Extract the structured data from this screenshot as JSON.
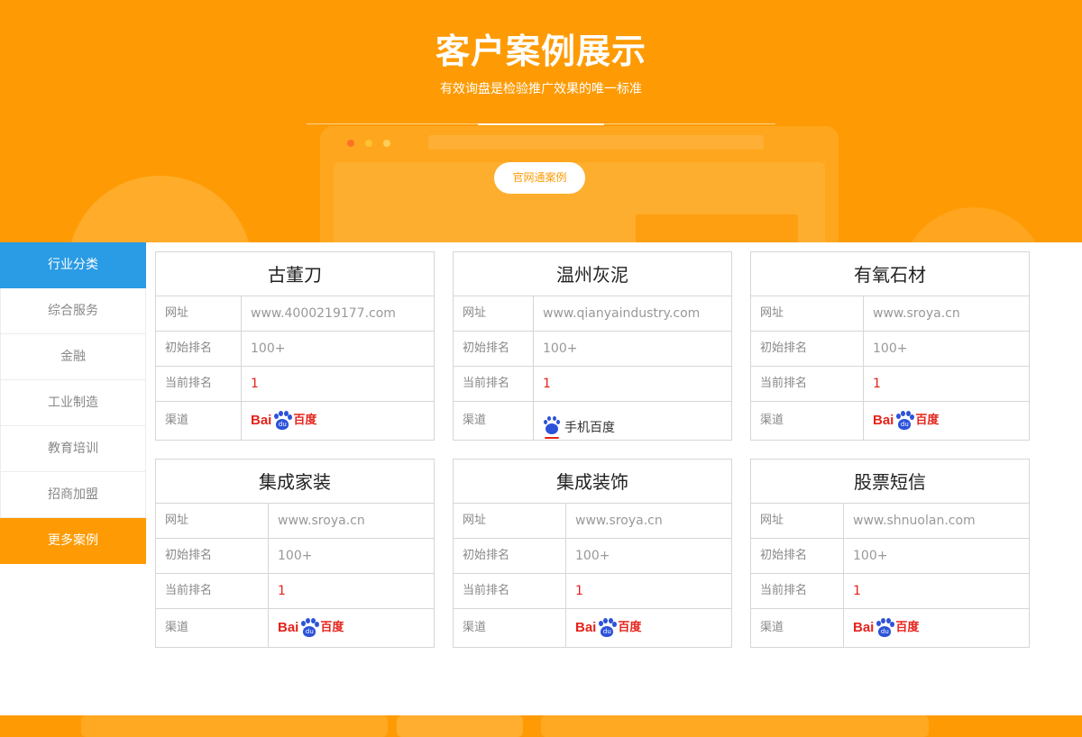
{
  "banner": {
    "title": "客户案例展示",
    "subtitle": "有效询盘是检验推广效果的唯一标准",
    "case_button": "官网通案例",
    "accent_color": "#fe9b04"
  },
  "sidebar": {
    "header": "行业分类",
    "items": [
      "综合服务",
      "金融",
      "工业制造",
      "教育培训",
      "招商加盟"
    ],
    "more": "更多案例",
    "header_color": "#2a9be5"
  },
  "labels": {
    "url": "网址",
    "initial_rank": "初始排名",
    "current_rank": "当前排名",
    "channel": "渠道"
  },
  "channel_logos": {
    "baidu_latin": "Bai",
    "baidu_du": "du",
    "baidu_cn": "百度",
    "mobile_baidu": "手机百度"
  },
  "cards": [
    {
      "title": "古董刀",
      "url": "www.4000219177.com",
      "initial_rank": "100+",
      "current_rank": "1",
      "channel": "baidu"
    },
    {
      "title": "温州灰泥",
      "url": "www.qianyaindustry.com",
      "initial_rank": "100+",
      "current_rank": "1",
      "channel": "mobile-baidu"
    },
    {
      "title": "有氧石材",
      "url": "www.sroya.cn",
      "initial_rank": "100+",
      "current_rank": "1",
      "channel": "baidu"
    },
    {
      "title": "集成家装",
      "url": "www.sroya.cn",
      "initial_rank": "100+",
      "current_rank": "1",
      "channel": "baidu"
    },
    {
      "title": "集成装饰",
      "url": "www.sroya.cn",
      "initial_rank": "100+",
      "current_rank": "1",
      "channel": "baidu"
    },
    {
      "title": "股票短信",
      "url": "www.shnuolan.com",
      "initial_rank": "100+",
      "current_rank": "1",
      "channel": "baidu"
    }
  ]
}
